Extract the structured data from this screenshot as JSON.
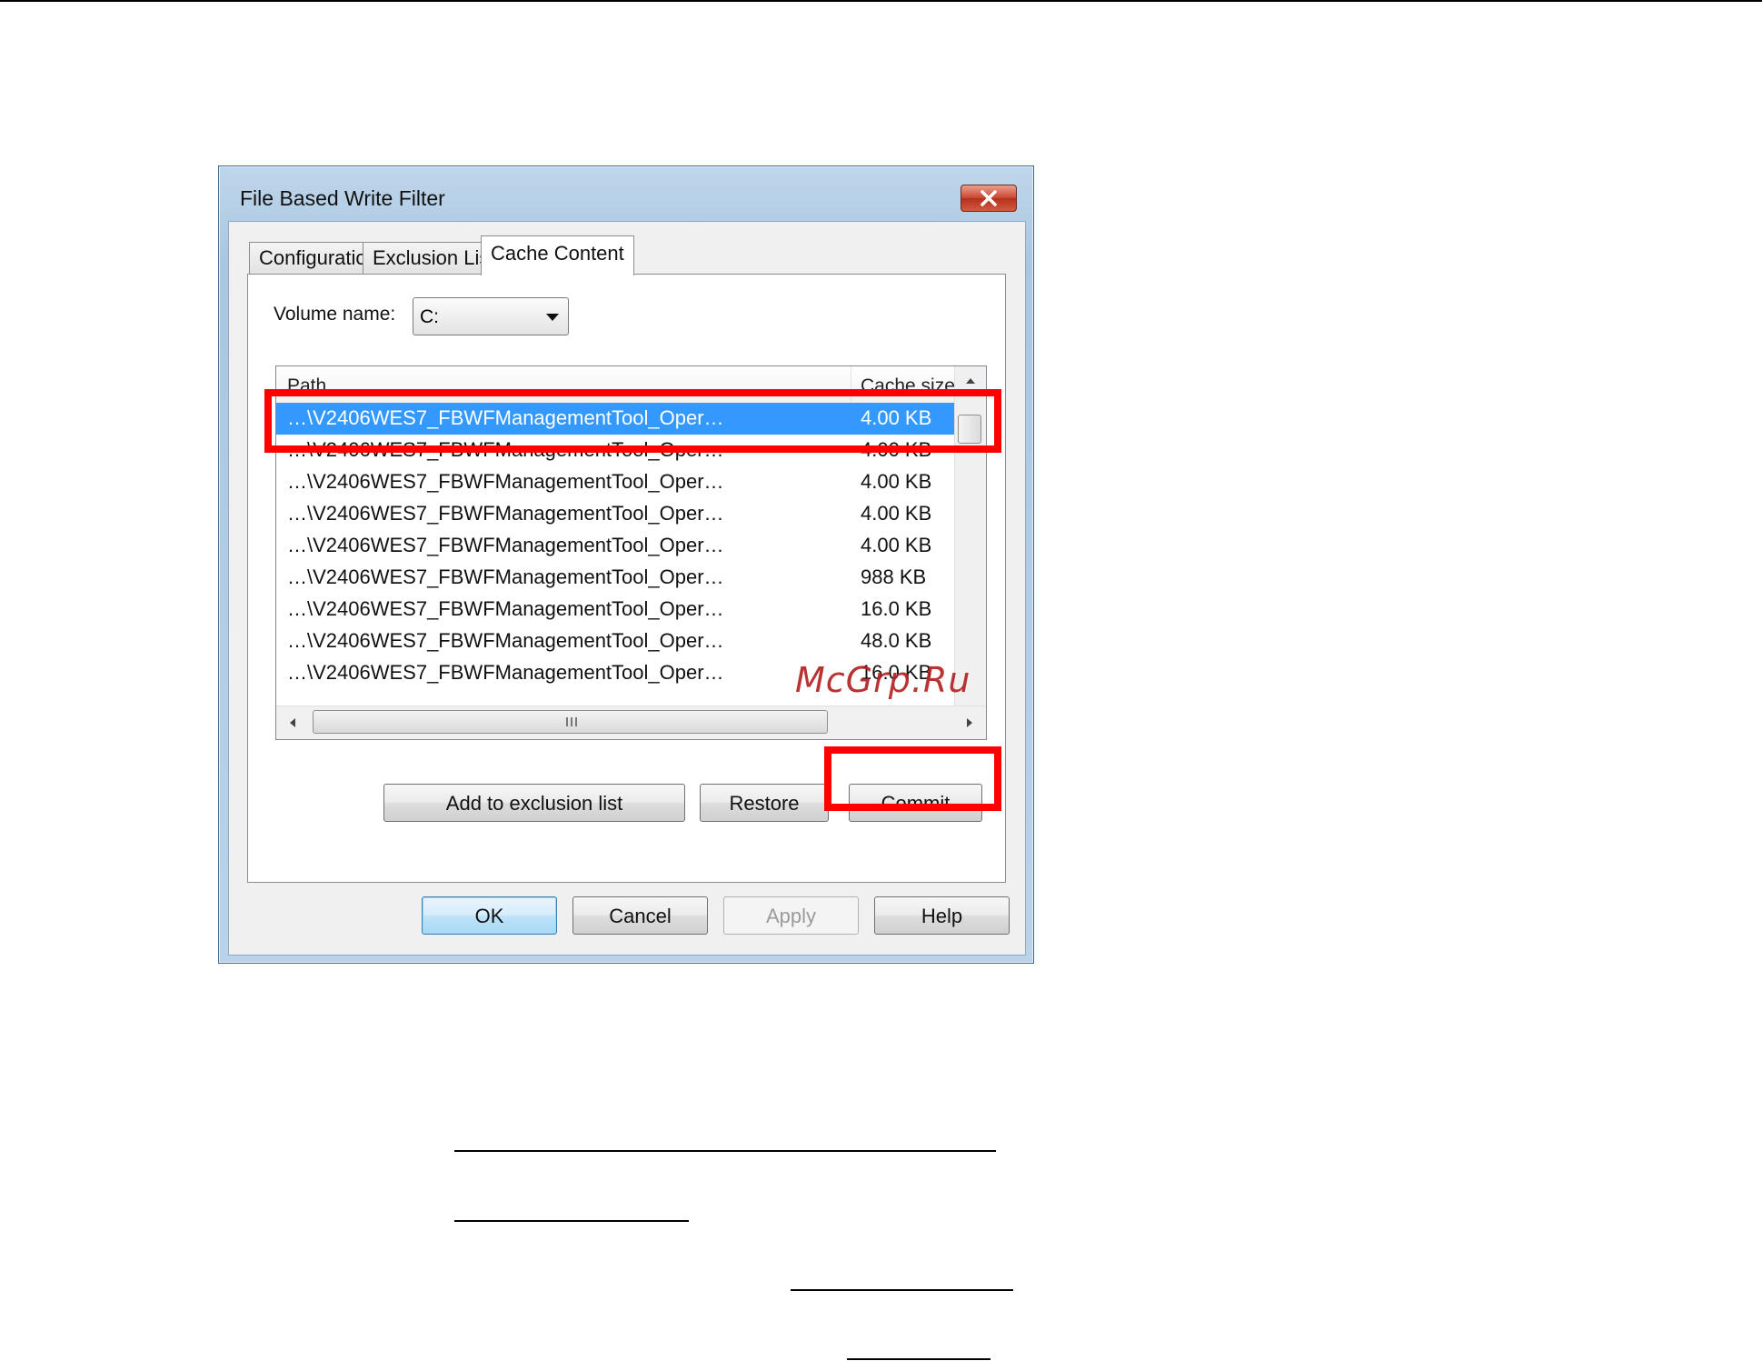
{
  "dialog": {
    "title": "File Based Write Filter",
    "close_label": "close"
  },
  "tabs": [
    {
      "label": "Configuration"
    },
    {
      "label": "Exclusion List"
    },
    {
      "label": "Cache Content"
    }
  ],
  "cache_content": {
    "volume_label": "Volume name:",
    "volume_value": "C:",
    "columns": {
      "path": "Path",
      "size": "Cache size"
    },
    "rows": [
      {
        "path": "…\\V2406WES7_FBWFManagementTool_Oper…",
        "size": "4.00 KB",
        "selected": true
      },
      {
        "path": "…\\V2406WES7_FBWFManagementTool_Oper…",
        "size": "4.00 KB"
      },
      {
        "path": "…\\V2406WES7_FBWFManagementTool_Oper…",
        "size": "4.00 KB"
      },
      {
        "path": "…\\V2406WES7_FBWFManagementTool_Oper…",
        "size": "4.00 KB"
      },
      {
        "path": "…\\V2406WES7_FBWFManagementTool_Oper…",
        "size": "4.00 KB"
      },
      {
        "path": "…\\V2406WES7_FBWFManagementTool_Oper…",
        "size": "988 KB"
      },
      {
        "path": "…\\V2406WES7_FBWFManagementTool_Oper…",
        "size": "16.0 KB"
      },
      {
        "path": "…\\V2406WES7_FBWFManagementTool_Oper…",
        "size": "48.0 KB"
      },
      {
        "path": "…\\V2406WES7_FBWFManagementTool_Oper…",
        "size": "16.0 KB"
      }
    ],
    "buttons": {
      "add_exclusion": "Add to exclusion list",
      "restore": "Restore",
      "commit": "Commit"
    }
  },
  "footer_buttons": {
    "ok": "OK",
    "cancel": "Cancel",
    "apply": "Apply",
    "help": "Help"
  },
  "watermark": "McGrp.Ru",
  "colors": {
    "highlight": "#ff0000",
    "selection": "#3399ff",
    "watermark": "#b22222"
  }
}
